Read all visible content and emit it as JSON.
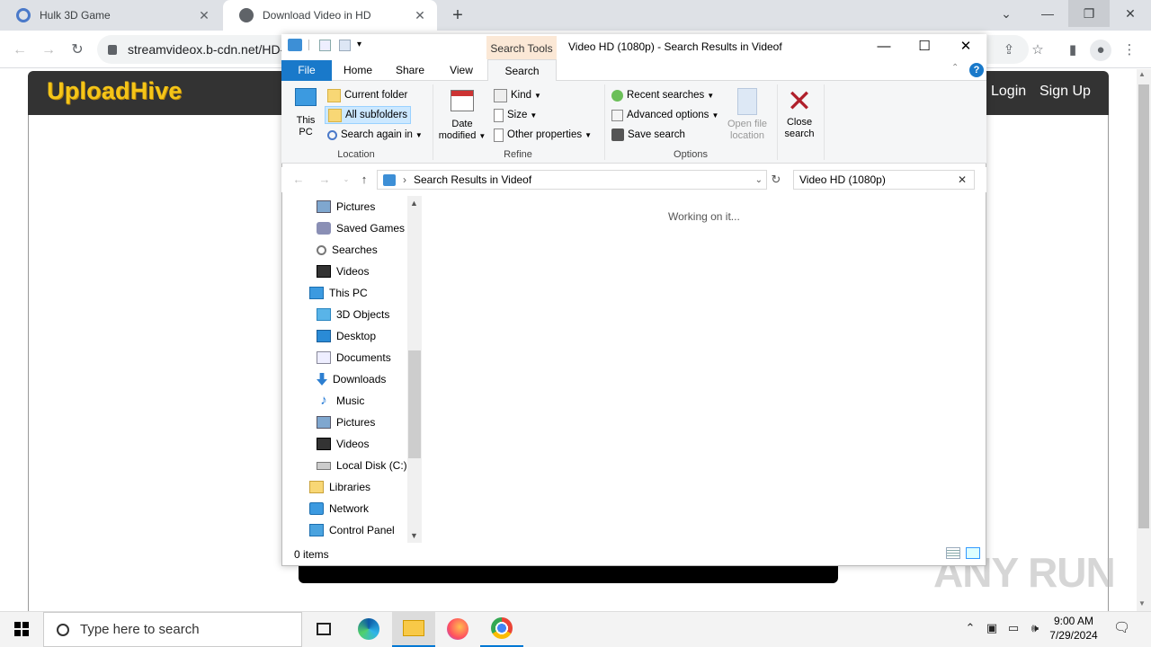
{
  "browser": {
    "tabs": [
      {
        "label": "Hulk 3D Game"
      },
      {
        "label": "Download Video in HD"
      }
    ],
    "new_tab": "+",
    "url": "streamvideox.b-cdn.net/HD-"
  },
  "site": {
    "logo": "UploadHive",
    "login": "Login",
    "signup": "Sign Up",
    "watermark": "ANY RUN"
  },
  "explorer": {
    "title": "Video HD (1080p) - Search Results in Videof",
    "context_tab": "Search Tools",
    "ribbon_tabs": [
      "File",
      "Home",
      "Share",
      "View",
      "Search"
    ],
    "location": {
      "this_pc": "This PC",
      "current_folder": "Current folder",
      "all_subfolders": "All subfolders",
      "search_again": "Search again in",
      "group": "Location"
    },
    "refine": {
      "date_modified": "Date modified",
      "kind": "Kind",
      "size": "Size",
      "other_properties": "Other properties",
      "group": "Refine"
    },
    "options": {
      "recent_searches": "Recent searches",
      "advanced_options": "Advanced options",
      "save_search": "Save search",
      "open_file_location": "Open file location",
      "group": "Options"
    },
    "close_search": "Close search",
    "address": "Search Results in Videof",
    "search_value": "Video HD (1080p)",
    "nav_items": [
      {
        "label": "Pictures",
        "icon": "pictures-icon"
      },
      {
        "label": "Saved Games",
        "icon": "saved-games-icon"
      },
      {
        "label": "Searches",
        "icon": "searches-icon"
      },
      {
        "label": "Videos",
        "icon": "videos-icon"
      },
      {
        "label": "This PC",
        "icon": "pc-icon"
      },
      {
        "label": "3D Objects",
        "icon": "3d-objects-icon"
      },
      {
        "label": "Desktop",
        "icon": "desktop-icon"
      },
      {
        "label": "Documents",
        "icon": "documents-icon"
      },
      {
        "label": "Downloads",
        "icon": "downloads-icon"
      },
      {
        "label": "Music",
        "icon": "music-icon"
      },
      {
        "label": "Pictures",
        "icon": "pictures-icon"
      },
      {
        "label": "Videos",
        "icon": "videos-icon"
      },
      {
        "label": "Local Disk (C:)",
        "icon": "disk-icon"
      },
      {
        "label": "Libraries",
        "icon": "libraries-icon"
      },
      {
        "label": "Network",
        "icon": "network-icon"
      },
      {
        "label": "Control Panel",
        "icon": "control-panel-icon"
      }
    ],
    "working": "Working on it...",
    "status": "0 items"
  },
  "taskbar": {
    "search_placeholder": "Type here to search",
    "time": "9:00 AM",
    "date": "7/29/2024"
  },
  "colors": {
    "file_tab": "#1979ca",
    "site_logo": "#f5c518",
    "site_header": "#333333",
    "close_search_x": "#b0202b"
  }
}
